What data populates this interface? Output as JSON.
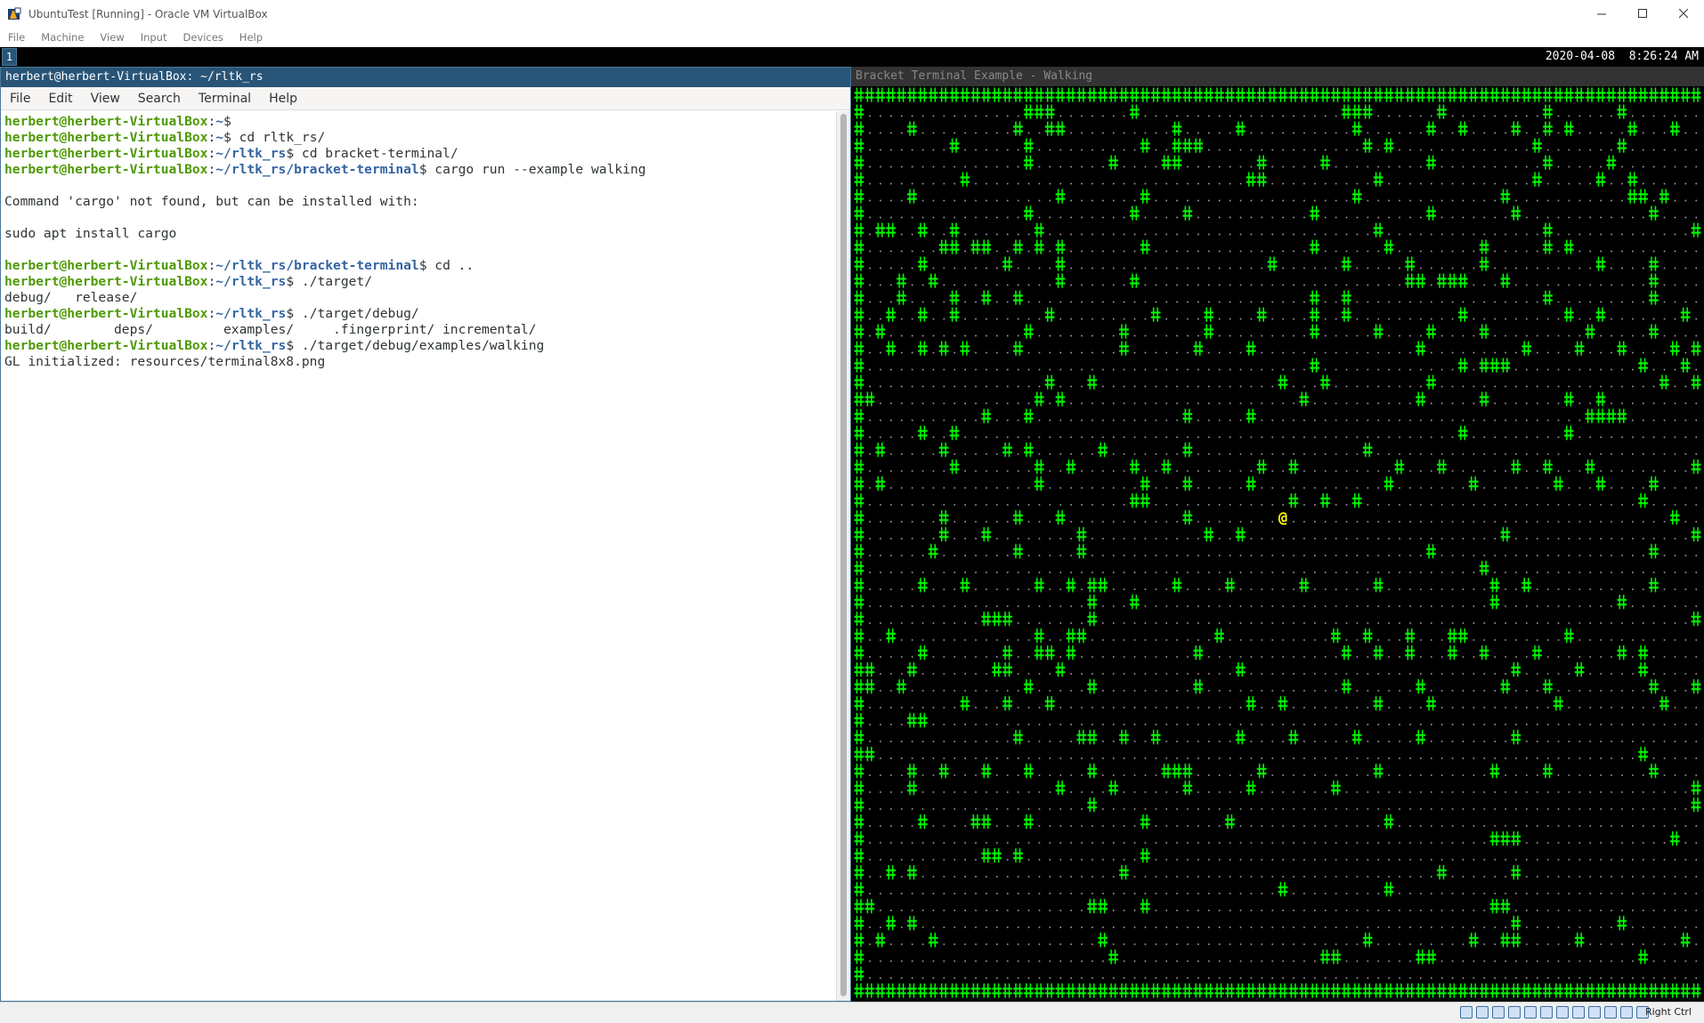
{
  "host": {
    "title": "UbuntuTest [Running] - Oracle VM VirtualBox",
    "menu": [
      "File",
      "Machine",
      "View",
      "Input",
      "Devices",
      "Help"
    ],
    "status_icons": [
      "hard-disk-icon",
      "optical-drive-icon",
      "audio-icon",
      "network-icon",
      "usb-icon",
      "shared-folder-icon",
      "display-icon",
      "recording-icon",
      "cpu-icon",
      "mouse-integration-icon",
      "keyboard-icon",
      "host-key-icon"
    ],
    "host_key": "Right Ctrl"
  },
  "topbar": {
    "workspace": "1",
    "clock": "2020-04-08  8:26:24 AM"
  },
  "terminal": {
    "title": "herbert@herbert-VirtualBox: ~/rltk_rs",
    "menu": [
      "File",
      "Edit",
      "View",
      "Search",
      "Terminal",
      "Help"
    ],
    "lines": [
      {
        "user": "herbert@herbert-VirtualBox",
        "path": "~",
        "cmd": ""
      },
      {
        "user": "herbert@herbert-VirtualBox",
        "path": "~",
        "cmd": " cd rltk_rs/"
      },
      {
        "user": "herbert@herbert-VirtualBox",
        "path": "~/rltk_rs",
        "cmd": " cd bracket-terminal/"
      },
      {
        "user": "herbert@herbert-VirtualBox",
        "path": "~/rltk_rs/bracket-terminal",
        "cmd": " cargo run --example walking"
      },
      {
        "text": ""
      },
      {
        "text": "Command 'cargo' not found, but can be installed with:"
      },
      {
        "text": ""
      },
      {
        "text": "sudo apt install cargo"
      },
      {
        "text": ""
      },
      {
        "user": "herbert@herbert-VirtualBox",
        "path": "~/rltk_rs/bracket-terminal",
        "cmd": " cd .."
      },
      {
        "user": "herbert@herbert-VirtualBox",
        "path": "~/rltk_rs",
        "cmd": " ./target/"
      },
      {
        "text": "debug/   release/"
      },
      {
        "user": "herbert@herbert-VirtualBox",
        "path": "~/rltk_rs",
        "cmd": " ./target/debug/"
      },
      {
        "text": "build/        deps/         examples/     .fingerprint/ incremental/"
      },
      {
        "user": "herbert@herbert-VirtualBox",
        "path": "~/rltk_rs",
        "cmd": " ./target/debug/examples/walking"
      },
      {
        "text": "GL initialized: resources/terminal8x8.png"
      }
    ]
  },
  "bracket": {
    "title": "Bracket Terminal Example - Walking",
    "wall_glyph": "#",
    "floor_glyph": ".",
    "player_glyph": "@",
    "wall_color": "#00ff00",
    "floor_color": "#aaaaaa",
    "player_color": "#ffff00",
    "map": [
      "################################################################################",
      "#...............###.......#...................###......#.........#......#.......#",
      "#....#.........#..##..........#.....#..........#......#..#....#..#.#.....#...#...",
      "#........#......#..........#..###...............#.#.............#.......#........",
      "#...............#.......#....##.......#.....#.........#..........#.....#.........",
      "#.........#..........................##..........#..............#.....#..#.......",
      "#....#.............#.......#...................#.............#...........##.#...#",
      "#...............#.........#....#...........#..........#.......#............#.....",
      "#.##..#..#.......#...............................#...............#.............#.#",
      "#.......##.##..#.#.#.......#...............#......#........#.....#.#.............",
      "#.....#.......#....#...................#......#.....#......#..........#....#.....",
      "#...#..#...........#......#.........................##.###...#.............#.....",
      "#...#....#..#..#...........................#..#..................#.........#.....",
      "#..#..#..#........#.........#....#....#....#..#..........#.........#..#.......#..",
      "#.#.............#........#.......#.........#.....#....#....#.........#.....#.....",
      "#..#..#.#.#....#.........#......#....#...............#.........#....#...#....#.#.",
      "#..........................................#.............#.###............#...#..",
      "#.................#...#.................#...#.........#.....................#..##",
      "##...............#.#......................#..........#.....#.......#..#..........",
      "#...........#...#..............#.....#...............................####........",
      "#.....#..#...............................................#.........#............#",
      "#.#.....#.....#.#......#.......#................#...............................#",
      "#........#.......#..#.....#..#........#..#.........#...#......#..#...#.........#.",
      "#.#..............#.........#...#.....#............#.......#.......#...#....#.....",
      "#.........................##.............#..#..#..........................#......",
      "#.......#......#...#...........#.............................................#...",
      "#.......#...#........#...........#..#........................#.................#.",
      "#......#.......#.....#................................#....................#.....",
      "#..........................................................#.....................",
      "#.....#...#......#..#.##......#....#......#......#..........#..#...........#.....",
      "#.....................#...#.................................#...........#........",
      "#...........###.......#........................................................#.",
      "#..#.............#..##............#..........#..#...#...##.........#.............",
      "#.....#.......#..##.#...........#.............#..#..#...#..#....#.......#.#.....#",
      "##...#.......##....#................#.........................#.....#.....#......",
      "##..#...........#.....#.........#.............#......#.......#...#.........#...##",
      "#.........#...#...#..................#..#........#....#...........#.........#....",
      "#....##..........................................................................",
      "#..............#.....##..#..#.......#....#.....#.....#........#.................#",
      "##........................................................................#......",
      "#....#..#...#...#.....#......###......#..........#..........#....#.........#.....",
      "#....#.............#....#......#.....#.......#.................................#.",
      "#.....................#........................................................#.",
      "#.....#....##...#..........#.......#..............#..............................",
      "#...........................................................###..............#...",
      "#...........##.#...........#.....................................................",
      "#..#.#...................#.............................#......#..................",
      "#.......................................#.........#..............................",
      "##....................##...#................................##...................",
      "#..#.#........................................................#.........#.......#",
      "#.#....#...............#........................#.........#..##.....#.........#..",
      "#.......................#...................##.......##...................#......",
      "#................................................................................",
      "################################################################################"
    ],
    "player": {
      "row": 25,
      "col": 40
    }
  }
}
